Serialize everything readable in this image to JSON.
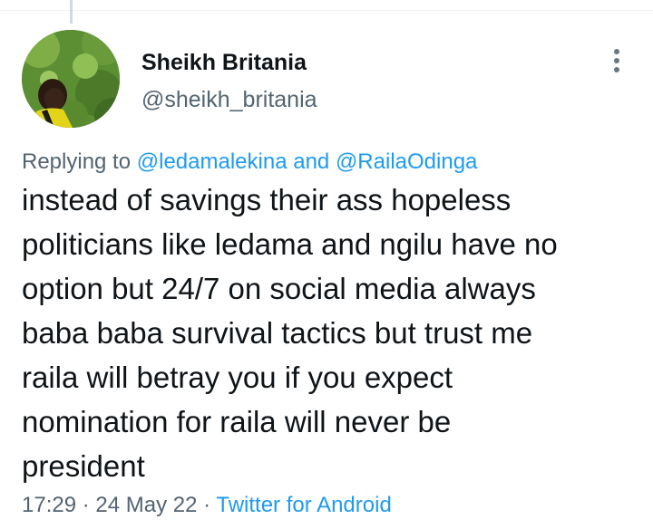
{
  "author": {
    "display_name": "Sheikh Britania",
    "handle": "@sheikh_britania"
  },
  "icons": {
    "more": "more-vertical-icon"
  },
  "reply": {
    "prefix": "Replying to ",
    "mention_1": "@ledamalekina",
    "conjunction": " and ",
    "mention_2": "@RailaOdinga"
  },
  "tweet": {
    "text": "instead of savings their ass hopeless\npoliticians like ledama and ngilu have no\noption but 24/7 on social media always\nbaba baba survival tactics but trust me\nraila will betray you if you expect\nnomination for raila will never be\npresident"
  },
  "meta": {
    "time": "17:29",
    "separator_1": " · ",
    "date": "24 May 22",
    "separator_2": " · ",
    "source": "Twitter for Android"
  },
  "colors": {
    "link": "#1d9bf0",
    "secondary_text": "#536471",
    "primary_text": "#0f1419"
  }
}
